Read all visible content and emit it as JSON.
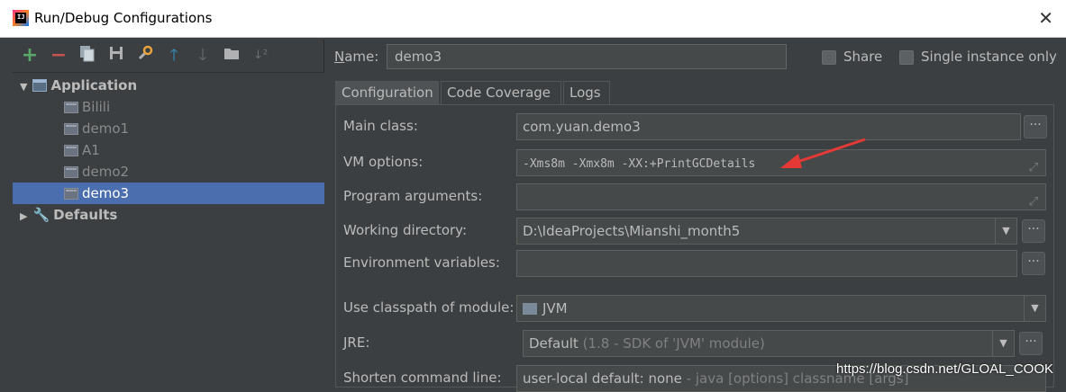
{
  "window": {
    "title": "Run/Debug Configurations"
  },
  "toolbar": {
    "icons": [
      "add-icon",
      "remove-icon",
      "copy-icon",
      "save-icon",
      "wrench-icon",
      "move-up-icon",
      "move-down-icon",
      "folder-icon",
      "sort-icon"
    ]
  },
  "tree": {
    "application": "Application",
    "items": [
      "Bilili",
      "demo1",
      "A1",
      "demo2",
      "demo3"
    ],
    "defaults": "Defaults"
  },
  "name_label_pre": "N",
  "name_label_rest": "ame:",
  "name_value": "demo3",
  "share_label": "Share",
  "single_instance_label": "Single instance only",
  "tabs": [
    "Configuration",
    "Code Coverage",
    "Logs"
  ],
  "form": {
    "main_class_label": "Main class:",
    "main_class_value": "com.yuan.demo3",
    "vm_options_label": "VM options:",
    "vm_options_value": "-Xms8m -Xmx8m -XX:+PrintGCDetails",
    "program_args_label": "Program arguments:",
    "working_dir_label": "Working directory:",
    "working_dir_value": "D:\\IdeaProjects\\Mianshi_month5",
    "env_vars_label": "Environment variables:",
    "classpath_label": "Use classpath of module:",
    "classpath_value": "JVM",
    "jre_label": "JRE:",
    "jre_value": "Default",
    "jre_hint": "(1.8 - SDK of 'JVM' module)",
    "shorten_label": "Shorten command line:",
    "shorten_value": "user-local default: none",
    "shorten_hint": "- java [options] classname [args]"
  },
  "watermark": "https://blog.csdn.net/GLOAL_COOK",
  "colors": {
    "selection": "#4b6eaf",
    "arrow": "#e53935",
    "background": "#3c3f41"
  }
}
